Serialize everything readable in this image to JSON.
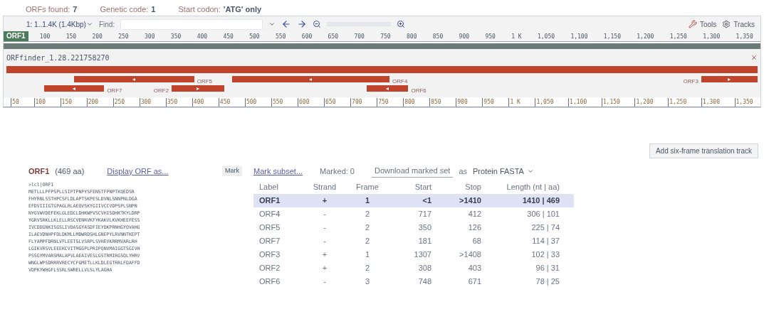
{
  "summary": [
    {
      "label": "ORFs found:",
      "value": "7"
    },
    {
      "label": "Genetic code:",
      "value": "1"
    },
    {
      "label": "Start codon:",
      "value": "'ATG' only"
    }
  ],
  "toolbar": {
    "range": "1: 1..1.4K (1.4Kbp)",
    "find_label": "Find:",
    "tools": "Tools",
    "tracks": "Tracks"
  },
  "ruler": {
    "track_label": "ORF1",
    "ticks": [
      "100",
      "150",
      "200",
      "250",
      "300",
      "350",
      "400",
      "450",
      "500",
      "550",
      "600",
      "650",
      "700",
      "750",
      "800",
      "850",
      "900",
      "950",
      "1 K",
      "1,050",
      "1,100",
      "1,150",
      "1,200",
      "1,250",
      "1,300",
      "1,350"
    ]
  },
  "bottom_ruler": {
    "ticks": [
      "50",
      "100",
      "150",
      "200",
      "250",
      "300",
      "350",
      "400",
      "450",
      "500",
      "550",
      "600",
      "650",
      "700",
      "750",
      "800",
      "850",
      "900",
      "950",
      "1 K",
      "1,050",
      "1,100",
      "1,150",
      "1,200",
      "1,250",
      "1,300",
      "1,350"
    ]
  },
  "track": {
    "title": "ORFfinder_1.28.221758270"
  },
  "features": [
    {
      "label": "ORF5",
      "arrow": "◂"
    },
    {
      "label": "ORF4",
      "arrow": "◂"
    },
    {
      "label": "ORF3",
      "arrow": "▸"
    },
    {
      "label": "ORF7",
      "arrow": "◂"
    },
    {
      "label": "ORF2",
      "arrow": "▸"
    },
    {
      "label": "ORF6",
      "arrow": "◂"
    }
  ],
  "add_track_button": "Add six-frame translation track",
  "orf_panel": {
    "title": "ORF1",
    "length": "(469 aa)",
    "display_link": "Display ORF as...",
    "mark_button": "Mark",
    "sequence": [
      ">lcl|ORF1",
      "METLLLPFPSPLLSIPTPNPYSFENSTFPNPTKQEDSR",
      "FHYRNLSSTHPCSFLDLAPTSKPESLDVNLSNNPNLDGA",
      "EFDVIIIGTGPAGLRLAEQVSKYGIIVCCVDPSPLSNPN",
      "NYGVWVDEFEKLGLEDCLDHKWPVSCVHISDHKTKYLDRP",
      "YGRVSRKLLKLELLRSCVENRVKFYKAKVLKVKHEEFESS",
      "IVCDDGNKISGSLIVDASGYASDFIEYDKPRNHGYQVAHG",
      "ILAEVDNHPFDLDKMLLMDWRDSHLGNEPYLRVNNTKEPT",
      "FLYAMPFDRNLVFLEETSLVSRPLSVHEVKRRMVARLRH",
      "LGIKVRSVLEEEKCVITMGGPLPRIPQNVMAIGGTSGIVH",
      "PSSGYMVARSMALAPVLAEAIVESLGSTRMIRGSQLYHRV",
      "WNGLWPSDRRRVRECYCFGMETLLKLDLEGTRRLFDAFFD",
      "VDPKYWHGFLSSRLSWRELLVLSLYLAGHA"
    ]
  },
  "table": {
    "mark_subset": "Mark subset...",
    "marked": "Marked: 0",
    "download": "Download marked set",
    "as": "as",
    "format": "Protein FASTA",
    "columns": [
      "Label",
      "Strand",
      "Frame",
      "Start",
      "Stop",
      "Length (nt | aa)"
    ],
    "rows": [
      {
        "label": "ORF1",
        "strand": "+",
        "frame": "1",
        "start": "<1",
        "stop": ">1410",
        "length": "1410 | 469",
        "selected": true
      },
      {
        "label": "ORF4",
        "strand": "-",
        "frame": "2",
        "start": "717",
        "stop": "412",
        "length": "306 | 101",
        "selected": false
      },
      {
        "label": "ORF5",
        "strand": "-",
        "frame": "2",
        "start": "350",
        "stop": "126",
        "length": "225 | 74",
        "selected": false
      },
      {
        "label": "ORF7",
        "strand": "-",
        "frame": "2",
        "start": "181",
        "stop": "68",
        "length": "114 | 37",
        "selected": false
      },
      {
        "label": "ORF3",
        "strand": "+",
        "frame": "1",
        "start": "1307",
        "stop": ">1408",
        "length": "102 | 33",
        "selected": false
      },
      {
        "label": "ORF2",
        "strand": "+",
        "frame": "2",
        "start": "308",
        "stop": "403",
        "length": "96 | 31",
        "selected": false
      },
      {
        "label": "ORF6",
        "strand": "-",
        "frame": "3",
        "start": "748",
        "stop": "671",
        "length": "78 | 25",
        "selected": false
      }
    ]
  }
}
